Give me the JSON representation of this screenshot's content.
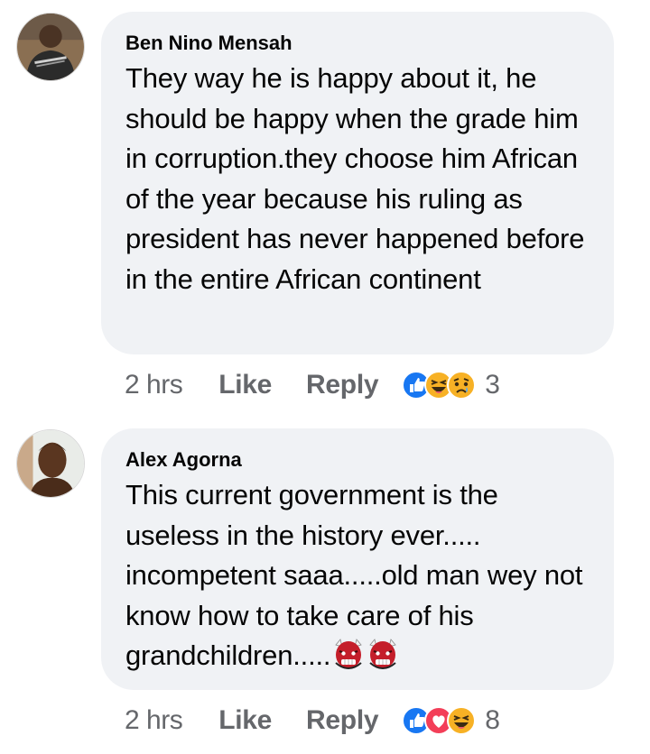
{
  "comments": [
    {
      "author": "Ben Nino Mensah",
      "text": "They way he is happy about it, he should be happy when the grade him in corruption.they choose him African of the year because his ruling as president has never happened before in the entire African continent",
      "time": "2 hrs",
      "like_label": "Like",
      "reply_label": "Reply",
      "reaction_icons": [
        "like-icon",
        "laughing-icon",
        "sad-icon"
      ],
      "reaction_count": "3"
    },
    {
      "author": "Alex Agorna",
      "text": "This current government is the useless in the history ever..... incompetent saaa.....old man wey not know how to take care of his grandchildren.....",
      "text_emojis": [
        "ogre-icon",
        "ogre-icon"
      ],
      "time": "2 hrs",
      "like_label": "Like",
      "reply_label": "Reply",
      "reaction_icons": [
        "like-icon",
        "love-icon",
        "laughing-icon"
      ],
      "reaction_count": "8"
    }
  ],
  "colors": {
    "bubble": "#f0f2f5",
    "text": "#050505",
    "meta": "#65676b",
    "like_blue": "#1877f2",
    "love_red": "#f33e58",
    "emoji_yellow": "#f7b125"
  }
}
